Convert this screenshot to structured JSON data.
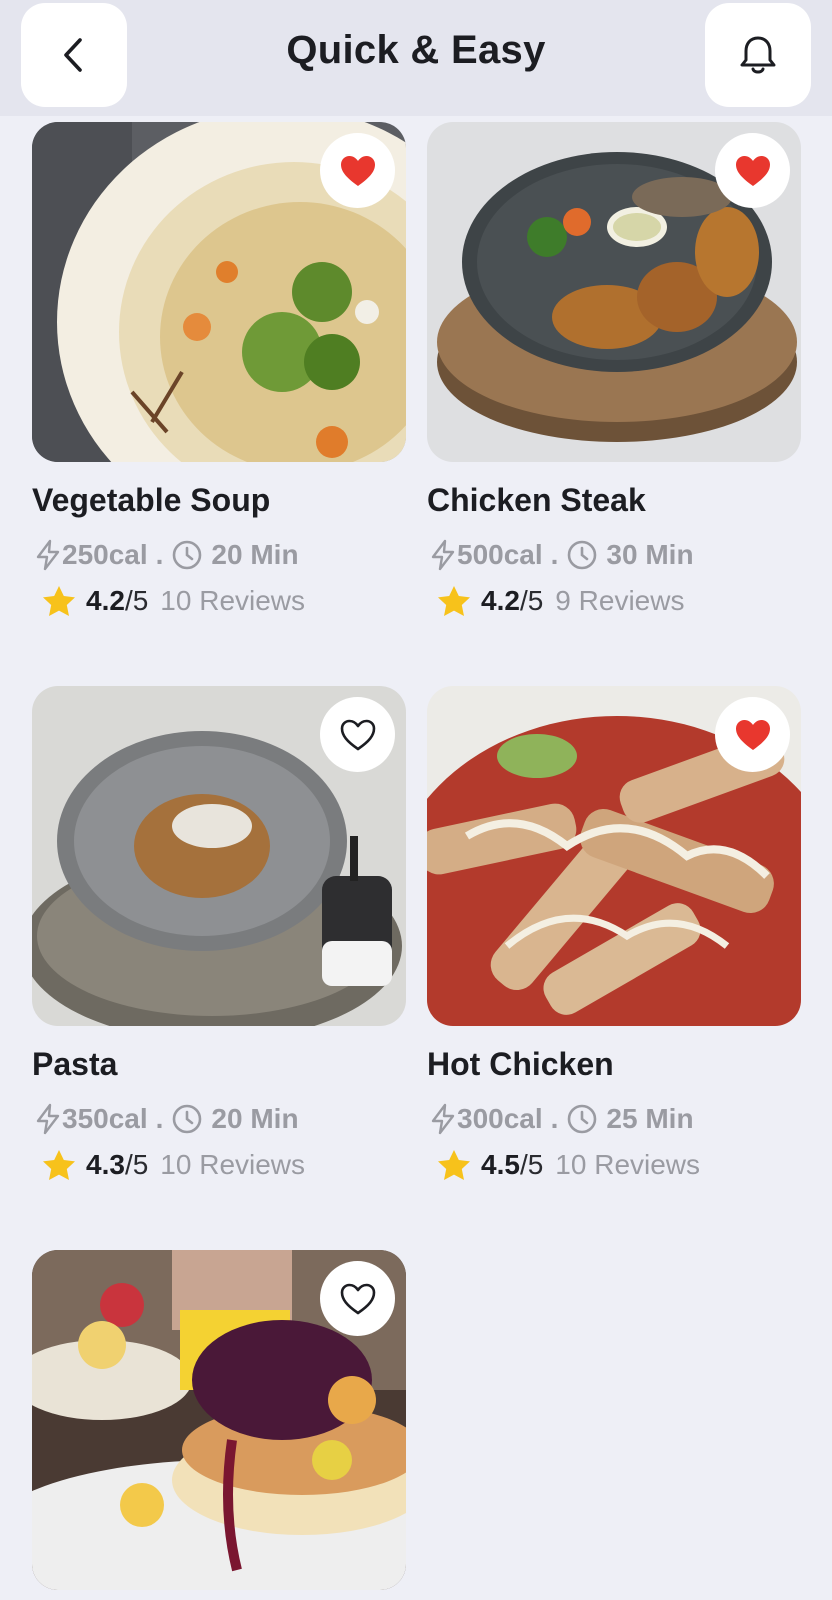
{
  "header": {
    "title": "Quick & Easy",
    "back_icon": "chevron-left-icon",
    "notification_icon": "bell-icon"
  },
  "colors": {
    "favorite": "#e8372e",
    "star": "#f7c21b",
    "muted_text": "#9a9ba2",
    "background": "#eeeff6"
  },
  "recipes": [
    {
      "name": "Vegetable Soup",
      "calories": "250cal",
      "separator": ".",
      "time": "20 Min",
      "rating": "4.2",
      "out_of": "/5",
      "reviews": "10 Reviews",
      "favorited": true
    },
    {
      "name": "Chicken Steak",
      "calories": "500cal",
      "separator": ".",
      "time": "30 Min",
      "rating": "4.2",
      "out_of": "/5",
      "reviews": "9 Reviews",
      "favorited": true
    },
    {
      "name": "Pasta",
      "calories": "350cal",
      "separator": ".",
      "time": "20 Min",
      "rating": "4.3",
      "out_of": "/5",
      "reviews": "10 Reviews",
      "favorited": false
    },
    {
      "name": "Hot Chicken",
      "calories": "300cal",
      "separator": ".",
      "time": "25 Min",
      "rating": "4.5",
      "out_of": "/5",
      "reviews": "10 Reviews",
      "favorited": true
    },
    {
      "favorited": false
    }
  ]
}
